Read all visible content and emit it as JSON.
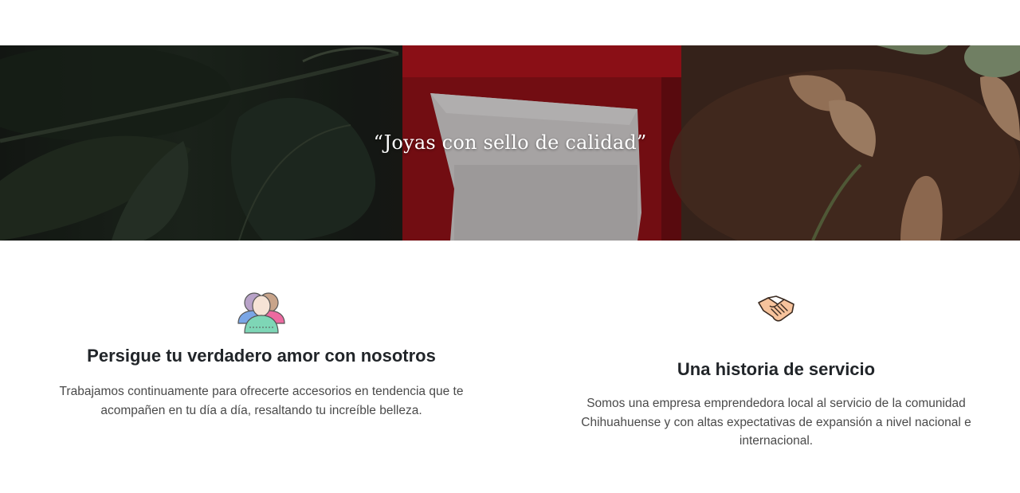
{
  "hero": {
    "quote": "“Joyas con sello de calidad”",
    "image": "jewelry-box-photo"
  },
  "features": [
    {
      "icon": "users-group-icon",
      "title": "Persigue tu verdadero amor con nosotros",
      "text": "Trabajamos continuamente para ofrecerte accesorios en tendencia que te acompañen en tu día a día, resaltando tu increíble belleza."
    },
    {
      "icon": "handshake-icon",
      "title": "Una historia de servicio",
      "text": "Somos una empresa emprendedora local al servicio de la comunidad Chihuahuense y con altas expectativas de expansión a nivel nacional e internacional."
    }
  ],
  "colors": {
    "text": "#212529",
    "box_red": "#b0141c",
    "hero_dark": "#1c211c"
  }
}
